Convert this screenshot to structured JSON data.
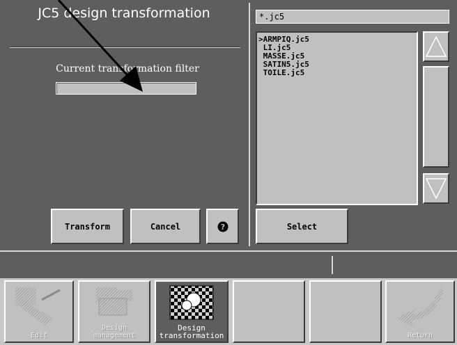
{
  "app": {
    "title": "JC5 design transformation"
  },
  "left_panel": {
    "filter_label": "Current transformation filter",
    "filter_value": ""
  },
  "buttons": {
    "transform": "Transform",
    "cancel": "Cancel",
    "help": "?",
    "select": "Select"
  },
  "file_browser": {
    "pattern": "*.jc5",
    "items": [
      ">ARMPIQ.jc5",
      " LI.jc5",
      " MASSE.jc5",
      " SATIN5.jc5",
      " TOILE.jc5"
    ]
  },
  "toolbar": {
    "items": [
      {
        "label": "Edit",
        "icon": "edit-icon"
      },
      {
        "label": "Design\nmanagement",
        "icon": "design-management-icon"
      },
      {
        "label": "Design\ntransformation",
        "icon": "design-transformation-icon"
      },
      {
        "label": "",
        "icon": ""
      },
      {
        "label": "",
        "icon": ""
      },
      {
        "label": "Return",
        "icon": "return-arrow-icon"
      }
    ]
  }
}
